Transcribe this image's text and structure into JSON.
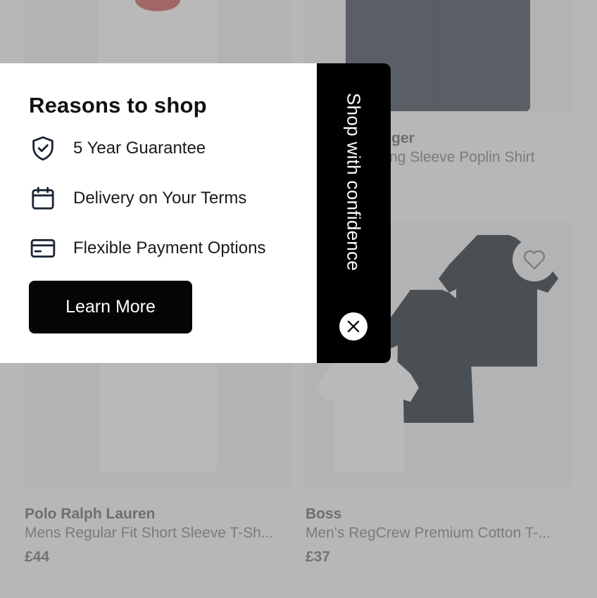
{
  "products": [
    {
      "brand": "Polo Ralph Lauren",
      "name": "Mens Regular Fit Short Sleeve T-Sh...",
      "price": "£44"
    },
    {
      "brand": "Boss",
      "name": "Men's RegCrew Premium Cotton T-...",
      "price": "£37"
    }
  ],
  "top_right_product": {
    "brand_partial": "ger",
    "name_partial": "ng Sleeve Poplin Shirt"
  },
  "panel": {
    "title": "Reasons to shop",
    "reasons": [
      {
        "icon": "shield-check-icon",
        "label": "5 Year Guarantee"
      },
      {
        "icon": "calendar-icon",
        "label": "Delivery on Your Terms"
      },
      {
        "icon": "credit-card-icon",
        "label": "Flexible Payment Options"
      }
    ],
    "cta_label": "Learn More"
  },
  "side_tab": {
    "label": "Shop with confidence",
    "close_icon": "close-icon"
  },
  "colors": {
    "panel_bg": "#ffffff",
    "tab_bg": "#000000",
    "overlay": "rgba(128,128,128,0.55)"
  }
}
